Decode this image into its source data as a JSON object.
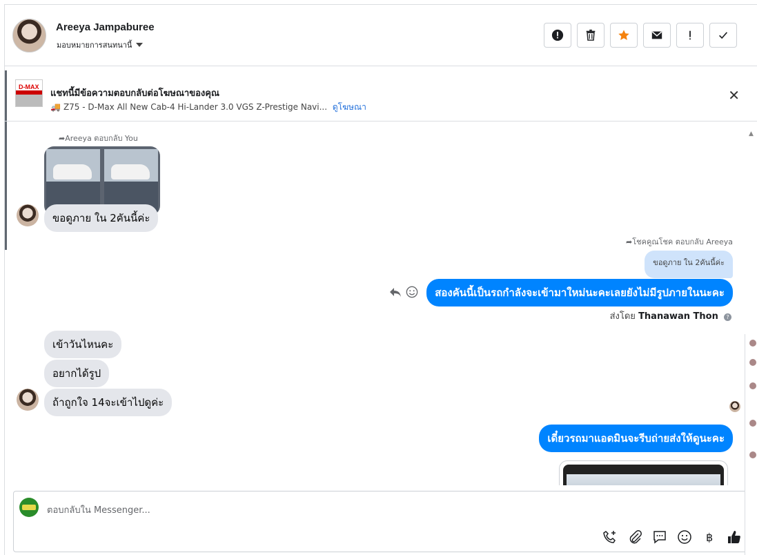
{
  "header": {
    "name": "Areeya Jampaburee",
    "assign_label": "มอบหมายการสนทนานี้",
    "actions": [
      {
        "id": "spam",
        "icon": "alert-circle-icon"
      },
      {
        "id": "delete",
        "icon": "trash-icon"
      },
      {
        "id": "star",
        "icon": "star-icon",
        "color": "#f5820d"
      },
      {
        "id": "mail",
        "icon": "mail-icon"
      },
      {
        "id": "important",
        "icon": "exclamation-icon"
      },
      {
        "id": "done",
        "icon": "check-icon"
      }
    ]
  },
  "ad": {
    "thumb_text": "D-MAX",
    "title": "แชทนี้มีข้อความตอบกลับต่อโฆษณาของคุณ",
    "subtitle": "Z75 - D-Max All New Cab-4 Hi-Lander 3.0 VGS Z-Prestige Navi...",
    "link": "ดูโฆษณา",
    "close": "✕"
  },
  "messages": {
    "reply_note_1": "Areeya ตอบกลับ You",
    "in_1": "ขอดูภาย ใน 2คันนี้ค่ะ",
    "reply_note_2": "โชคคูณโชค ตอบกลับ Areeya",
    "quoted": "ขอดูภาย ใน 2คันนี้ค่ะ",
    "out_1": "สองคันนี้เป็นรถกำลังจะเข้ามาใหม่นะคะเลยยังไม่มีรูปภายในนะคะ",
    "sent_by_label": "ส่งโดย",
    "sent_by_name": "Thanawan Thon",
    "in_2": "เข้าวันไหนคะ",
    "in_3": "อยากได้รูป",
    "in_4": "ถ้าถูกใจ 14จะเข้าไปดูค่ะ",
    "out_2": "เดี๋ยวรถมาแอดมินจะรีบถ่ายส่งให้ดูนะคะ"
  },
  "composer": {
    "placeholder": "ตอบกลับใน Messenger...",
    "tools": [
      "phone-plus-icon",
      "paperclip-icon",
      "quick-reply-icon",
      "emoji-icon",
      "baht-icon",
      "thumbs-up-icon"
    ],
    "accent": "#0084ff"
  }
}
